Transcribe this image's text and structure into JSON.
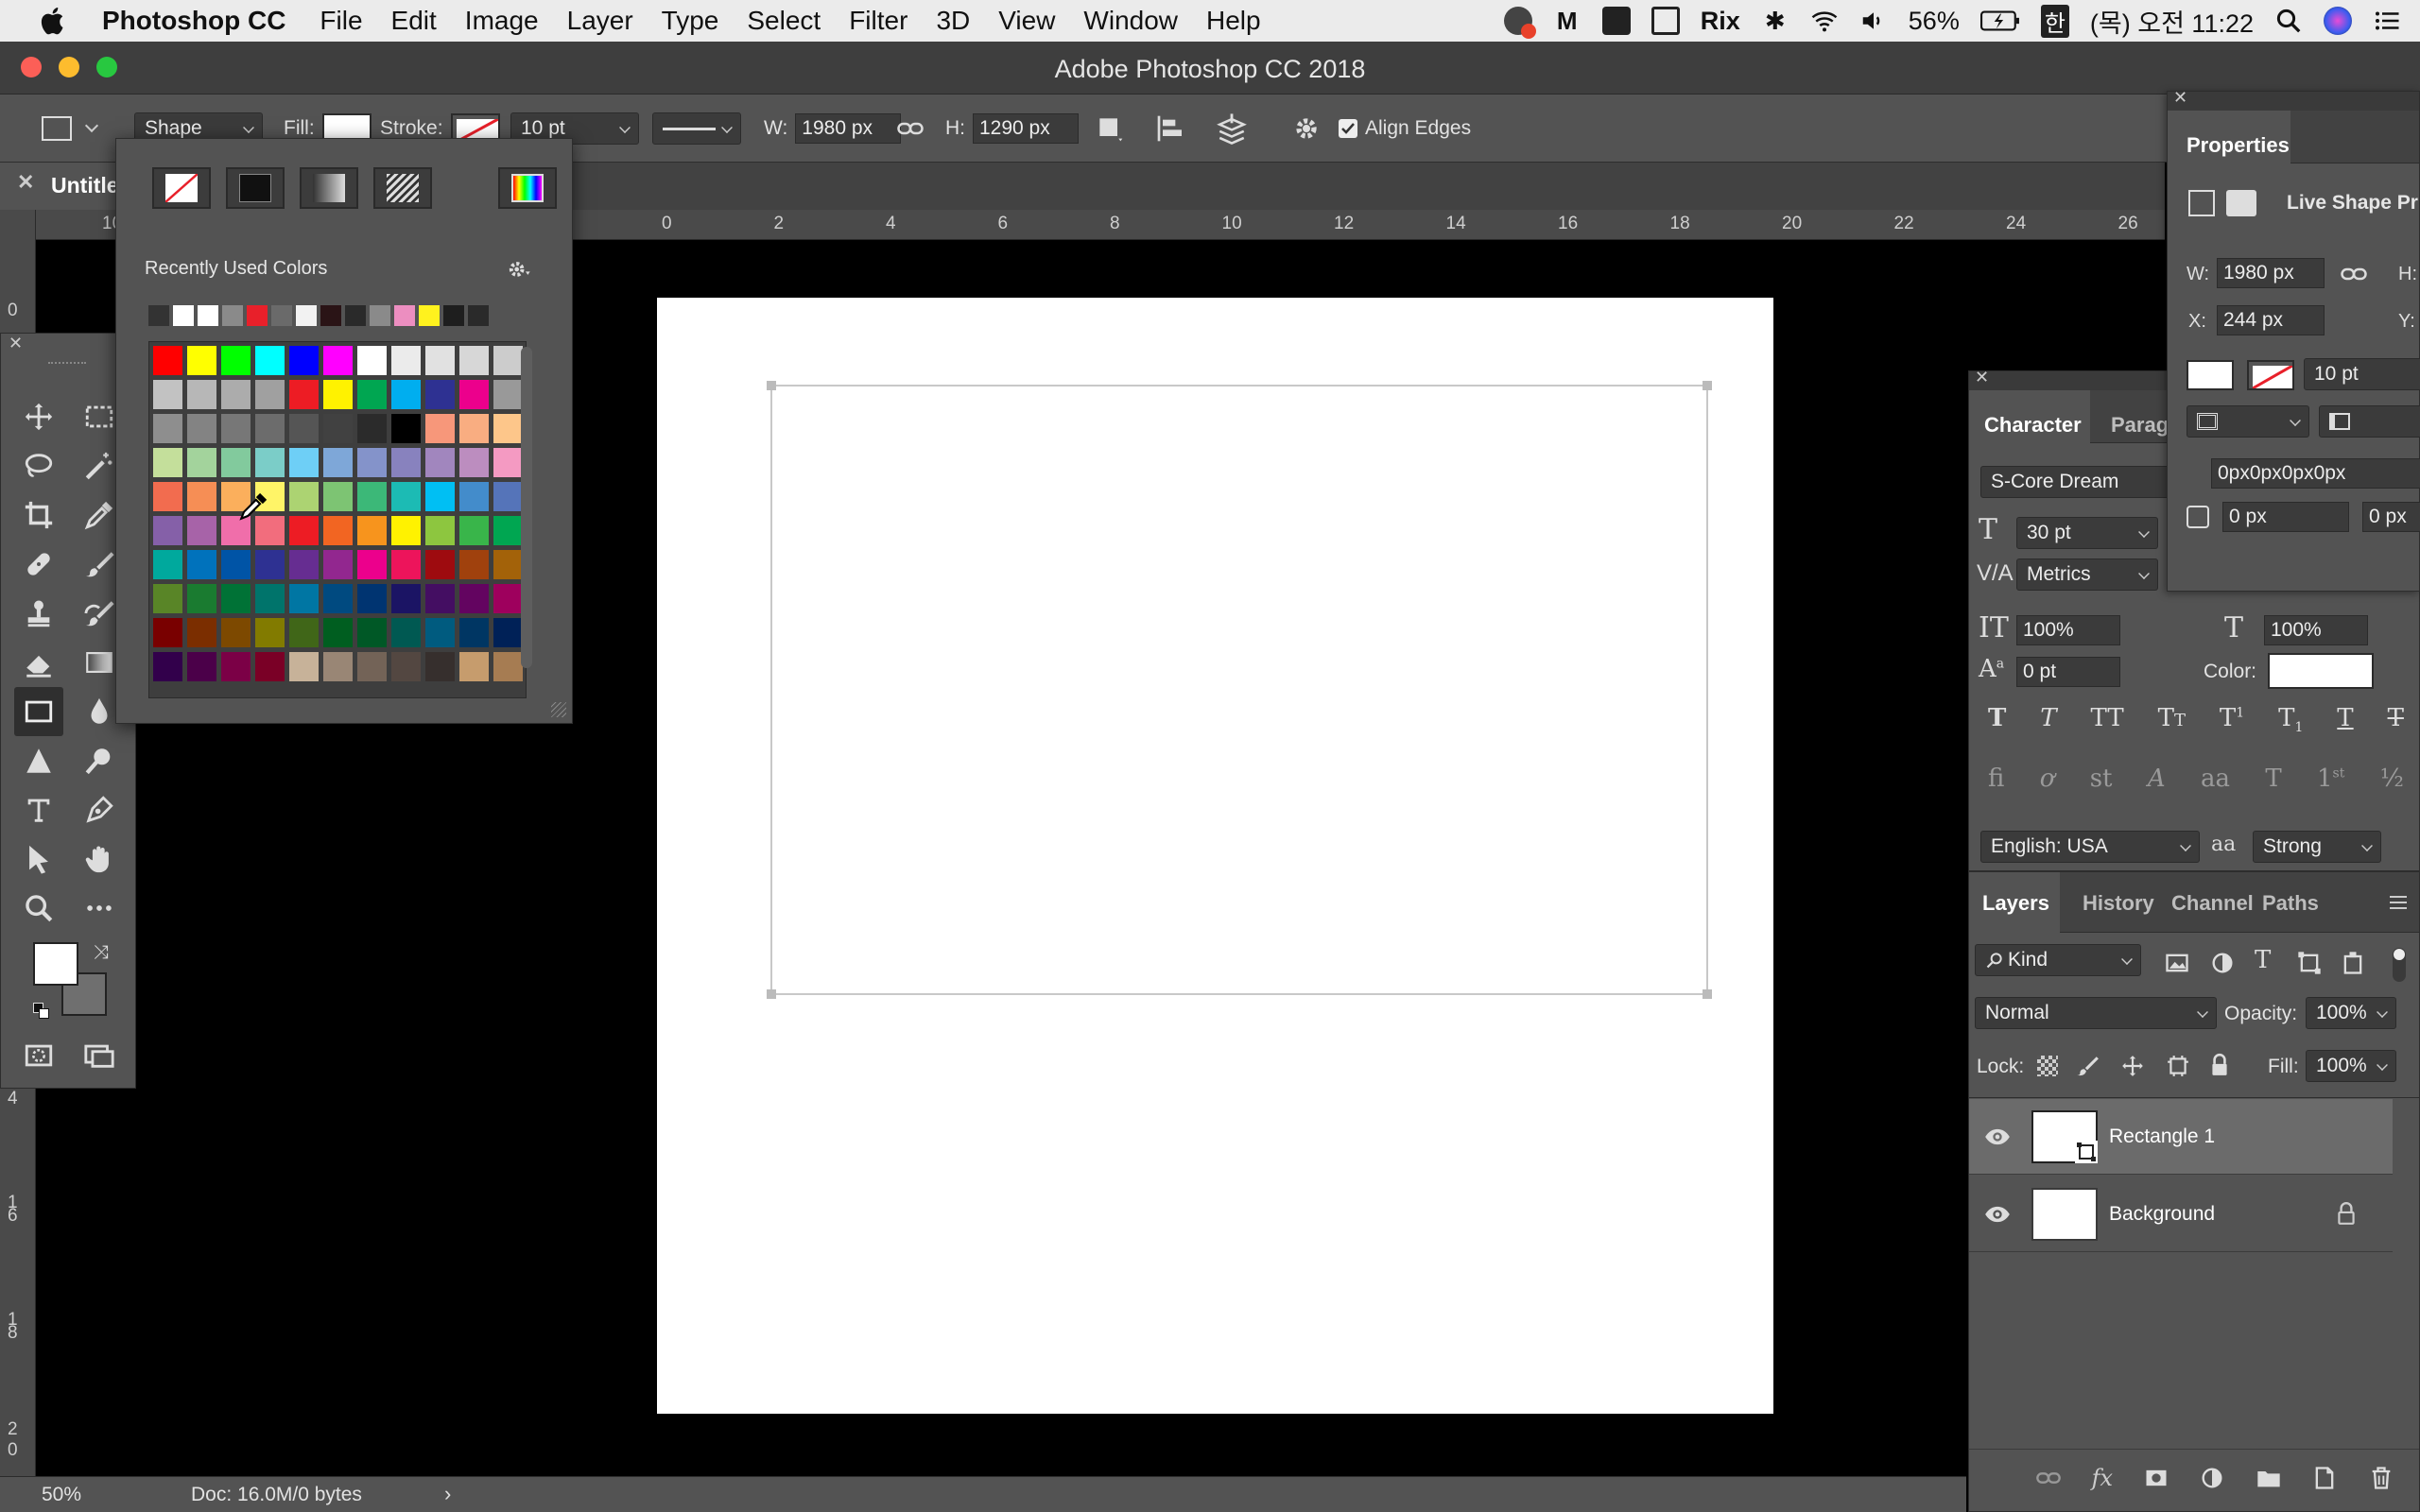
{
  "menubar": {
    "app_name": "Photoshop CC",
    "items": [
      "File",
      "Edit",
      "Image",
      "Layer",
      "Type",
      "Select",
      "Filter",
      "3D",
      "View",
      "Window",
      "Help"
    ],
    "rix": "Rix",
    "battery": "56%",
    "input_method": "한",
    "clock": "(목) 오전 11:22"
  },
  "window": {
    "title": "Adobe Photoshop CC 2018"
  },
  "options": {
    "mode": "Shape",
    "fill_label": "Fill:",
    "stroke_label": "Stroke:",
    "stroke_width": "10 pt",
    "w_label": "W:",
    "w_value": "1980 px",
    "h_label": "H:",
    "h_value": "1290 px",
    "align_edges": "Align Edges"
  },
  "document": {
    "tab_title": "Untitle",
    "ruler_top": [
      "0",
      "2",
      "4",
      "6",
      "8",
      "10",
      "12",
      "14",
      "16",
      "18",
      "20",
      "22",
      "24",
      "26"
    ],
    "ruler_top_left": "10",
    "ruler_left": [
      "0",
      "4",
      "6",
      "8",
      "0"
    ],
    "ruler_left_2": [
      "1",
      "1",
      "2"
    ],
    "zoom": "50%",
    "doc_info": "Doc: 16.0M/0 bytes"
  },
  "swatches": {
    "recent_label": "Recently Used Colors",
    "recent": [
      "#333333",
      "#ffffff",
      "#ffffff",
      "#8a8a8a",
      "#e8202a",
      "#6a6a6a",
      "#f2f2f2",
      "#2a1416",
      "#2a2a2a",
      "#8a8a8a",
      "#ec8ec0",
      "#fff21e",
      "#1e1e1e",
      "#2a2a2a"
    ],
    "grid": [
      [
        "#ff0000",
        "#ffff00",
        "#00ff00",
        "#00ffff",
        "#0000ff",
        "#ff00ff",
        "#ffffff",
        "#ebebeb",
        "#e1e1e1",
        "#d7d7d7",
        "#cccccc"
      ],
      [
        "#c2c2c2",
        "#b7b7b7",
        "#acacac",
        "#a0a0a0",
        "#ed1c24",
        "#fff200",
        "#00a651",
        "#00aeef",
        "#2e3192",
        "#ec008c",
        "#999999"
      ],
      [
        "#8e8e8e",
        "#838383",
        "#777777",
        "#6c6c6c",
        "#555555",
        "#414141",
        "#2b2b2b",
        "#000000",
        "#f7977a",
        "#f9ad81",
        "#fdc68a"
      ],
      [
        "#c4df9b",
        "#a3d39c",
        "#82ca9d",
        "#7bcdc8",
        "#6ecff6",
        "#7ea7d8",
        "#8493ca",
        "#8882be",
        "#a186be",
        "#bc8dbf",
        "#f49ac2"
      ],
      [
        "#f26c4f",
        "#f68e55",
        "#fbaf5c",
        "#fff467",
        "#acd372",
        "#7dc473",
        "#3cb878",
        "#1cbbb4",
        "#00bff3",
        "#438ccb",
        "#5574b9"
      ],
      [
        "#8560a8",
        "#a763a8",
        "#f06eaa",
        "#f26d7d",
        "#ed1c24",
        "#f26522",
        "#f7941d",
        "#fff200",
        "#8dc63f",
        "#39b54a",
        "#00a651"
      ],
      [
        "#00a99d",
        "#0072bc",
        "#0054a6",
        "#2e3192",
        "#662d91",
        "#92278f",
        "#ec008c",
        "#ed145b",
        "#9e0b0f",
        "#a0410d",
        "#a36209"
      ],
      [
        "#598527",
        "#1a7b30",
        "#007236",
        "#00746b",
        "#0076a3",
        "#004a80",
        "#003471",
        "#1b1464",
        "#440e62",
        "#630460",
        "#9e005d"
      ],
      [
        "#790000",
        "#7b2e00",
        "#7d4900",
        "#827b00",
        "#406618",
        "#005e20",
        "#005826",
        "#005952",
        "#005b7f",
        "#003663",
        "#002157"
      ],
      [
        "#32004b",
        "#4b0049",
        "#7b0046",
        "#7a0026",
        "#c7b299",
        "#998675",
        "#736357",
        "#534741",
        "#362f2d",
        "#c69c6d",
        "#a67c52"
      ]
    ]
  },
  "properties": {
    "title": "Properties",
    "subtitle": "Live Shape Pr",
    "w_label": "W:",
    "w_value": "1980 px",
    "h_label": "H:",
    "x_label": "X:",
    "x_value": "244 px",
    "y_label": "Y:",
    "stroke_width": "10 pt",
    "corners": "0px0px0px0px",
    "corner1": "0 px",
    "corner2": "0 px"
  },
  "character": {
    "tab1": "Character",
    "tab2": "Parag",
    "font": "S-Core Dream",
    "size": "30 pt",
    "kerning": "Metrics",
    "vscale": "100%",
    "hscale": "100%",
    "baseline": "0 pt",
    "color_label": "Color:",
    "language": "English: USA",
    "antialias_glyph": "aa",
    "antialias": "Strong"
  },
  "layers": {
    "tabs": [
      "Layers",
      "History",
      "Channel",
      "Paths"
    ],
    "filter_kind": "Kind",
    "blend_mode": "Normal",
    "opacity_label": "Opacity:",
    "opacity": "100%",
    "lock_label": "Lock:",
    "fill_label": "Fill:",
    "fill": "100%",
    "rows": [
      {
        "name": "Rectangle 1"
      },
      {
        "name": "Background"
      }
    ]
  },
  "colors": {
    "ui_dark": "#535353",
    "canvas_bg": "#000000",
    "traffic_red": "#fc5f57",
    "traffic_yellow": "#fdbc2e",
    "traffic_green": "#28c840"
  }
}
